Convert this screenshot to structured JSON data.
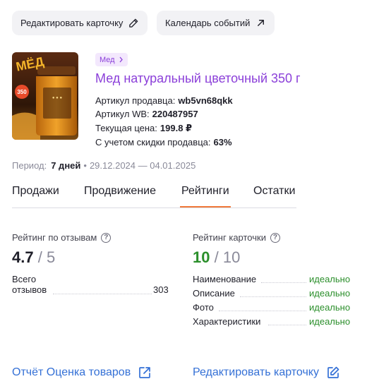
{
  "top_buttons": {
    "edit_card": "Редактировать карточку",
    "events_calendar": "Календарь событий"
  },
  "product": {
    "category": "Мед",
    "title": "Мед натуральный цветочный 350 г",
    "image_text": {
      "brand": "МЁД",
      "weight": "350"
    },
    "seller_article_label": "Артикул продавца:",
    "seller_article_value": "wb5vn68qkk",
    "wb_article_label": "Артикул WB:",
    "wb_article_value": "220487957",
    "price_label": "Текущая цена:",
    "price_value": "199.8 ₽",
    "discount_label": "С учетом скидки продавца:",
    "discount_value": "63%"
  },
  "period": {
    "label": "Период:",
    "value": "7 дней",
    "range": "29.12.2024 — 04.01.2025"
  },
  "tabs": [
    {
      "label": "Продажи"
    },
    {
      "label": "Продвижение"
    },
    {
      "label": "Рейтинги"
    },
    {
      "label": "Остатки"
    }
  ],
  "active_tab": "Рейтинги",
  "review_rating": {
    "label": "Рейтинг по отзывам",
    "value": "4.7",
    "separator": "/",
    "max": "5",
    "total_label_line1": "Всего",
    "total_label_line2": "отзывов",
    "total_value": "303"
  },
  "card_rating": {
    "label": "Рейтинг карточки",
    "value": "10",
    "separator": "/",
    "max": "10",
    "items": [
      {
        "name": "Наименование",
        "status": "идеально"
      },
      {
        "name": "Описание",
        "status": "идеально"
      },
      {
        "name": "Фото",
        "status": "идеально"
      },
      {
        "name": "Характеристики",
        "status": "идеально"
      }
    ]
  },
  "bottom_links": {
    "report": "Отчёт Оценка товаров",
    "edit_card": "Редактировать карточку"
  },
  "colors": {
    "accent_purple": "#8b3fd9",
    "link_blue": "#3470d6",
    "good_green": "#2b8f2b",
    "tab_underline": "#f07a3a"
  }
}
